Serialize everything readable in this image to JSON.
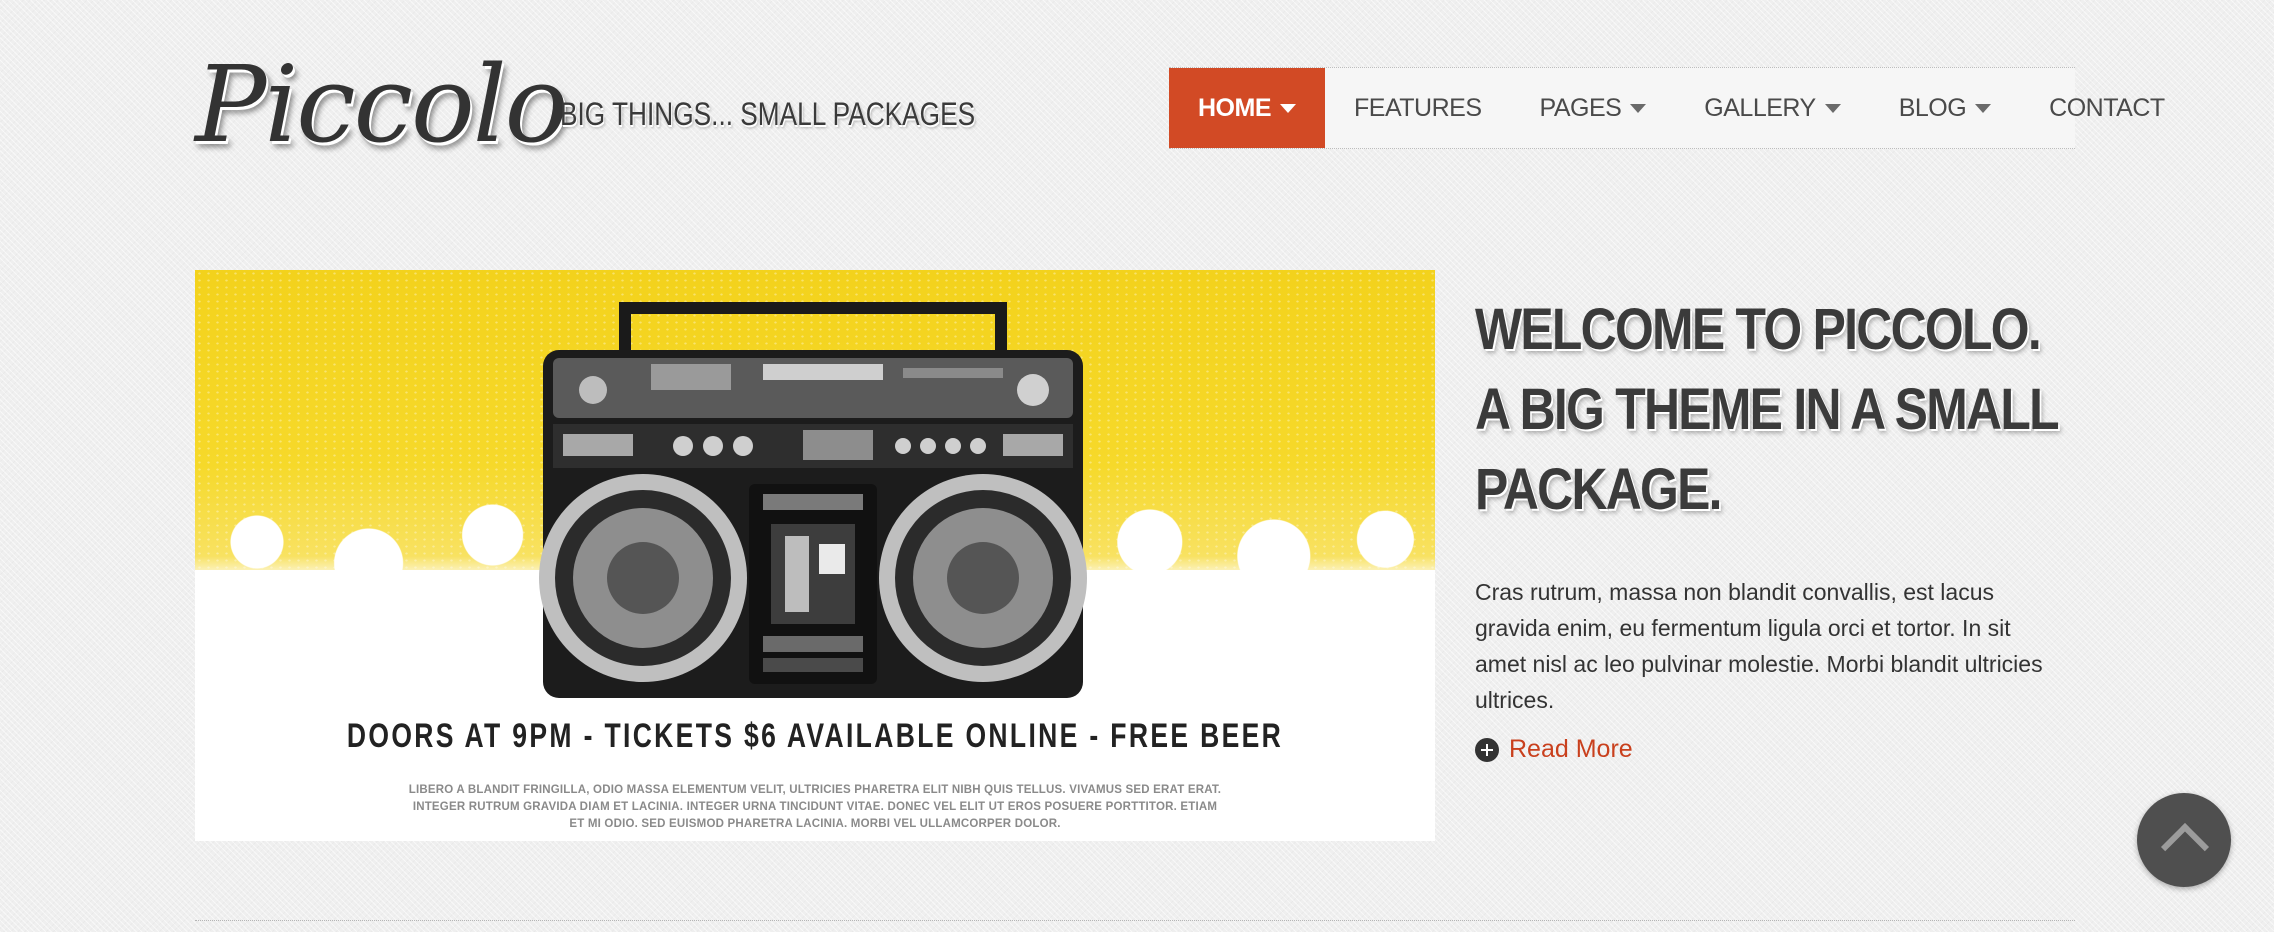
{
  "brand": {
    "logo": "Piccolo",
    "tagline": "BIG THINGS... SMALL PACKAGES"
  },
  "nav": {
    "items": [
      {
        "label": "HOME",
        "has_dropdown": true,
        "active": true
      },
      {
        "label": "FEATURES",
        "has_dropdown": false,
        "active": false
      },
      {
        "label": "PAGES",
        "has_dropdown": true,
        "active": false
      },
      {
        "label": "GALLERY",
        "has_dropdown": true,
        "active": false
      },
      {
        "label": "BLOG",
        "has_dropdown": true,
        "active": false
      },
      {
        "label": "CONTACT",
        "has_dropdown": false,
        "active": false
      }
    ]
  },
  "hero": {
    "headline": "DOORS AT 9PM - TICKETS $6 AVAILABLE ONLINE - FREE BEER",
    "fine_print": "LIBERO A BLANDIT FRINGILLA, ODIO MASSA ELEMENTUM VELIT, ULTRICIES PHARETRA ELIT NIBH QUIS TELLUS. VIVAMUS SED ERAT ERAT. INTEGER RUTRUM GRAVIDA DIAM ET LACINIA. INTEGER URNA TINCIDUNT VITAE. DONEC VEL ELIT UT EROS POSUERE PORTTITOR. ETIAM ET MI ODIO. SED EUISMOD PHARETRA LACINIA. MORBI VEL ULLAMCORPER DOLOR."
  },
  "welcome": {
    "line1": "WELCOME TO PICCOLO.",
    "line2": "A BIG THEME IN A SMALL",
    "line3": "PACKAGE.",
    "body": "Cras rutrum, massa non blandit convallis, est lacus gravida enim, eu fermentum ligula orci et tortor. In sit amet nisl ac leo pulvinar molestie. Morbi blandit ultricies ultrices.",
    "read_more": "Read More"
  },
  "icons": {
    "read_more": "plus-circle-icon",
    "back_to_top": "chevron-up-icon"
  },
  "colors": {
    "accent": "#d24a25",
    "link": "#c9401d",
    "hero_yellow": "#f5d624",
    "text": "#333333"
  }
}
